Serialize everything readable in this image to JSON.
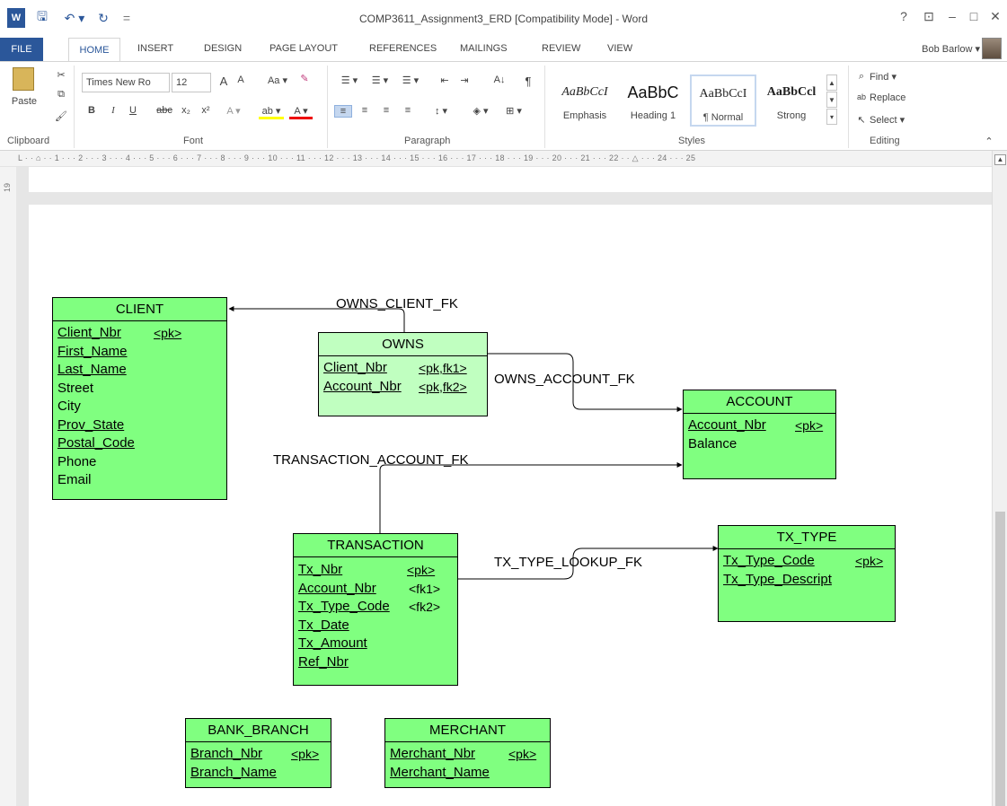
{
  "window": {
    "title": "COMP3611_Assignment3_ERD [Compatibility Mode] - Word",
    "help": "?",
    "ribbon_display": "⊡",
    "minimize": "–",
    "restore": "□",
    "close": "✕"
  },
  "quick_access": {
    "app_icon": "W",
    "save": "🖫",
    "undo": "↶ ▾",
    "redo": "↻",
    "customize": "="
  },
  "tabs": [
    "FILE",
    "HOME",
    "INSERT",
    "DESIGN",
    "PAGE LAYOUT",
    "REFERENCES",
    "MAILINGS",
    "REVIEW",
    "VIEW"
  ],
  "user": "Bob Barlow ▾",
  "ribbon": {
    "clipboard": {
      "paste": "Paste",
      "label": "Clipboard"
    },
    "font": {
      "name": "Times New Ro",
      "size": "12",
      "grow": "A",
      "shrink": "A",
      "case": "Aa ▾",
      "bold": "B",
      "italic": "I",
      "underline": "U",
      "strike": "abc",
      "subscript": "x₂",
      "superscript": "x²",
      "text_effects": "A ▾",
      "highlight": "ab ▾",
      "font_color": "A ▾",
      "label": "Font"
    },
    "paragraph": {
      "bullets": "☰ ▾",
      "numbering": "☰ ▾",
      "multilevel": "☰ ▾",
      "decrease_indent": "⇤",
      "increase_indent": "⇥",
      "sort": "A↓",
      "pilcrow": "¶",
      "align_left": "≡",
      "center": "≡",
      "align_right": "≡",
      "justify": "≡",
      "line_spacing": "↕ ▾",
      "shading": "◈ ▾",
      "borders": "⊞ ▾",
      "label": "Paragraph"
    },
    "styles": {
      "items": [
        {
          "sample": "AaBbCcI",
          "name": "Emphasis"
        },
        {
          "sample": "AaBbC",
          "name": "Heading 1"
        },
        {
          "sample": "AaBbCcI",
          "name": "¶ Normal"
        },
        {
          "sample": "AaBbCcl",
          "name": "Strong"
        }
      ],
      "label": "Styles"
    },
    "editing": {
      "find": "Find ▾",
      "replace": "Replace",
      "select": "Select ▾",
      "label": "Editing"
    }
  },
  "ruler": {
    "text": "L · · ⌂ · · 1 · · · 2 · · · 3 · · · 4 · · · 5 · · · 6 · · · 7 · · · 8 · · · 9 · · · 10 · · · 11 · · · 12 · · · 13 · · · 14 · · · 15 · · · 16 · · · 17 · · · 18 · · · 19 · · · 20 · · · 21 · · · 22 · · △ · · · 24 · · · 25",
    "vertical": "19"
  },
  "erd": {
    "client": {
      "name": "CLIENT",
      "attrs": [
        "Client_Nbr",
        "First_Name",
        "Last_Name",
        "Street",
        "City",
        "Prov_State",
        "Postal_Code",
        "Phone",
        "Email"
      ],
      "pk": "<pk>"
    },
    "owns": {
      "name": "OWNS",
      "attrs": [
        "Client_Nbr",
        "Account_Nbr"
      ],
      "keys": [
        "<pk,fk1>",
        "<pk,fk2>"
      ]
    },
    "account": {
      "name": "ACCOUNT",
      "attrs": [
        "Account_Nbr",
        "Balance"
      ],
      "pk": "<pk>"
    },
    "transaction": {
      "name": "TRANSACTION",
      "attrs": [
        "Tx_Nbr",
        "Account_Nbr",
        "Tx_Type_Code",
        "Tx_Date",
        "Tx_Amount",
        "Ref_Nbr"
      ],
      "keys": [
        "<pk>",
        "<fk1>",
        "<fk2>"
      ]
    },
    "tx_type": {
      "name": "TX_TYPE",
      "attrs": [
        "Tx_Type_Code",
        "Tx_Type_Descript"
      ],
      "pk": "<pk>"
    },
    "bank_branch": {
      "name": "BANK_BRANCH",
      "attrs": [
        "Branch_Nbr",
        "Branch_Name"
      ],
      "pk": "<pk>"
    },
    "merchant": {
      "name": "MERCHANT",
      "attrs": [
        "Merchant_Nbr",
        "Merchant_Name"
      ],
      "pk": "<pk>"
    },
    "relationships": [
      "OWNS_CLIENT_FK",
      "OWNS_ACCOUNT_FK",
      "TRANSACTION_ACCOUNT_FK",
      "TX_TYPE_LOOKUP_FK"
    ]
  }
}
